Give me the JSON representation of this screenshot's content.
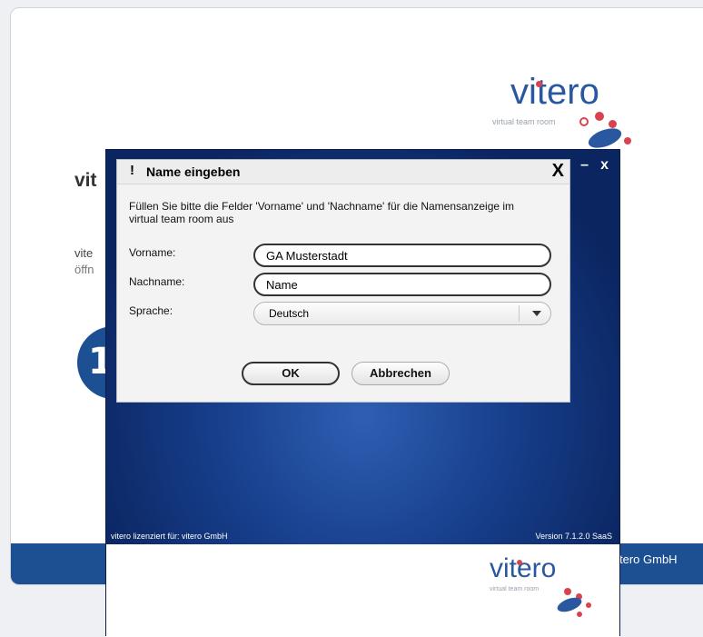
{
  "background_page": {
    "heading": "vit",
    "text_line1": "vite",
    "text_line2": "öffn",
    "circle_glyph": "1",
    "footer_text": "tero GmbH"
  },
  "logo": {
    "word": "vitero",
    "tagline": "virtual team room"
  },
  "client_window": {
    "minimize_label": "–",
    "close_label": "x",
    "license_text": "vitero lizenziert für: vitero GmbH",
    "version_text": "Version 7.1.2.0 SaaS"
  },
  "dialog": {
    "icon": "!",
    "title": "Name eingeben",
    "close_label": "X",
    "description": "Füllen Sie bitte die Felder 'Vorname' und 'Nachname' für die Namensanzeige im virtual team room aus",
    "fields": {
      "first_name": {
        "label": "Vorname:",
        "value": "GA Musterstadt"
      },
      "last_name": {
        "label": "Nachname:",
        "value": "Name"
      },
      "language": {
        "label": "Sprache:",
        "value": "Deutsch"
      }
    },
    "buttons": {
      "ok": "OK",
      "cancel": "Abbrechen"
    }
  },
  "colors": {
    "brand_blue": "#2a58a0",
    "logo_red": "#d9434f",
    "client_bg": "#173f8c"
  }
}
